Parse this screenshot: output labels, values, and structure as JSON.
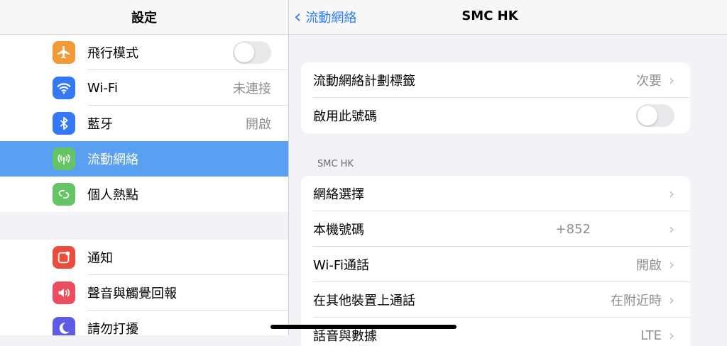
{
  "sidebar": {
    "title": "設定",
    "group1": [
      {
        "label": "飛行模式",
        "icon": "airplane-icon",
        "color": "#f19a37",
        "toggle": false
      },
      {
        "label": "Wi-Fi",
        "icon": "wifi-icon",
        "color": "#3478f6",
        "value": "未連接"
      },
      {
        "label": "藍牙",
        "icon": "bluetooth-icon",
        "color": "#3478f6",
        "value": "開啟"
      },
      {
        "label": "流動網絡",
        "icon": "cellular-icon",
        "color": "#65c466",
        "selected": true
      },
      {
        "label": "個人熱點",
        "icon": "hotspot-icon",
        "color": "#65c466"
      }
    ],
    "group2": [
      {
        "label": "通知",
        "icon": "notifications-icon",
        "color": "#eb4d3d"
      },
      {
        "label": "聲音與觸覺回報",
        "icon": "sound-icon",
        "color": "#eb4e61"
      },
      {
        "label": "請勿打擾",
        "icon": "moon-icon",
        "color": "#5e5ce6"
      }
    ]
  },
  "detail": {
    "back_label": "流動網絡",
    "title": "SMC HK",
    "card1": [
      {
        "label": "流動網絡計劃標籤",
        "value": "次要",
        "chevron": true
      },
      {
        "label": "啟用此號碼",
        "toggle": false
      }
    ],
    "section_label": "SMC HK",
    "card2": [
      {
        "label": "網絡選擇",
        "value": "",
        "chevron": true
      },
      {
        "label": "本機號碼",
        "value": "+852",
        "chevron": true
      },
      {
        "label": "Wi-Fi通話",
        "value": "開啟",
        "chevron": true
      },
      {
        "label": "在其他裝置上通話",
        "value": "在附近時",
        "chevron": true
      },
      {
        "label": "話音與數據",
        "value": "LTE",
        "chevron": true
      }
    ]
  },
  "colors": {
    "accent": "#2f7cf6",
    "selected_row": "#5aa0f2"
  }
}
